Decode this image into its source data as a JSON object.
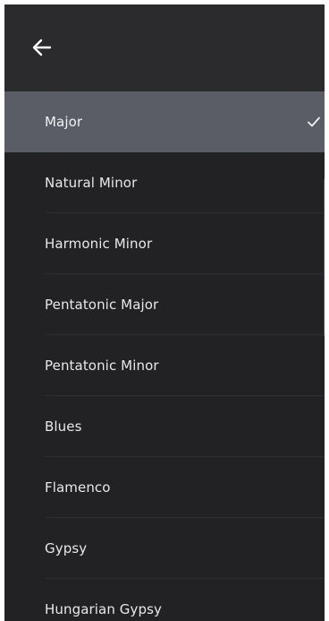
{
  "header": {
    "back_icon": "arrow-left-icon"
  },
  "scale_list": {
    "items": [
      {
        "label": "Major",
        "selected": true
      },
      {
        "label": "Natural Minor",
        "selected": false
      },
      {
        "label": "Harmonic Minor",
        "selected": false
      },
      {
        "label": "Pentatonic Major",
        "selected": false
      },
      {
        "label": "Pentatonic Minor",
        "selected": false
      },
      {
        "label": "Blues",
        "selected": false
      },
      {
        "label": "Flamenco",
        "selected": false
      },
      {
        "label": "Gypsy",
        "selected": false
      },
      {
        "label": "Hungarian Gypsy",
        "selected": false
      }
    ],
    "selected_icon": "checkmark-icon"
  },
  "colors": {
    "panel_background": "#222225",
    "header_background": "#2b2b2e",
    "selected_background": "#5a5d65",
    "text": "#e8e8ea"
  }
}
